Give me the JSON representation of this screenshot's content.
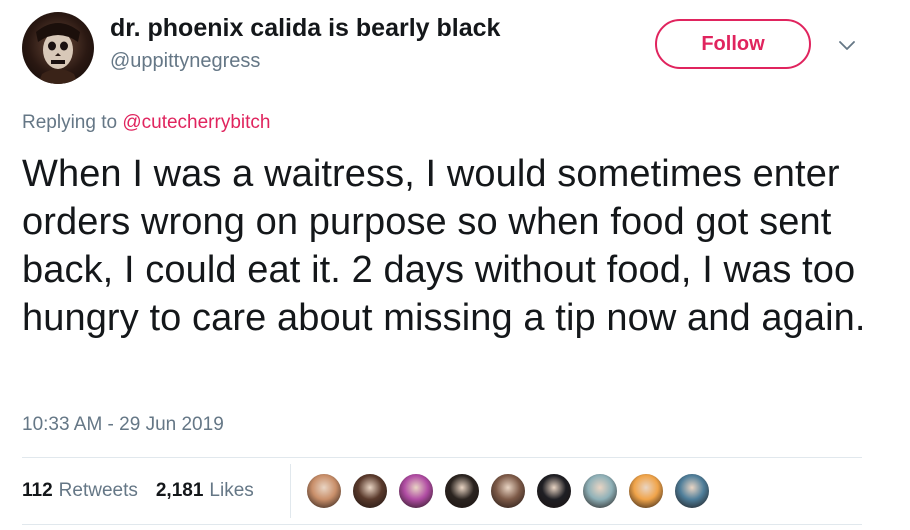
{
  "user": {
    "display_name": "dr. phoenix calida is bearly black",
    "handle": "@uppittynegress",
    "avatar_icon": "profile-avatar"
  },
  "header": {
    "follow_label": "Follow",
    "more_icon": "chevron-down-icon"
  },
  "reply": {
    "prefix": "Replying to",
    "mention": "@cutecherrybitch"
  },
  "tweet": {
    "text": "When I was a waitress, I would sometimes enter orders wrong on purpose so when food got sent back, I could eat it. 2 days without food, I was too hungry to care about missing a tip now and again.",
    "timestamp": "10:33 AM - 29 Jun 2019"
  },
  "stats": {
    "retweets_count": "112",
    "retweets_label": "Retweets",
    "likes_count": "2,181",
    "likes_label": "Likes"
  },
  "likers": [
    {
      "color": "#c98f6a"
    },
    {
      "color": "#5a3a2c"
    },
    {
      "color": "#b04ca3"
    },
    {
      "color": "#2b2420"
    },
    {
      "color": "#7d5a48"
    },
    {
      "color": "#1f1f24"
    },
    {
      "color": "#8fb1b8"
    },
    {
      "color": "#f0a44a"
    },
    {
      "color": "#4f7e9a"
    }
  ],
  "colors": {
    "accent": "#e0245e",
    "secondary_text": "#657786",
    "primary_text": "#14171a",
    "divider": "#e1e8ed"
  }
}
